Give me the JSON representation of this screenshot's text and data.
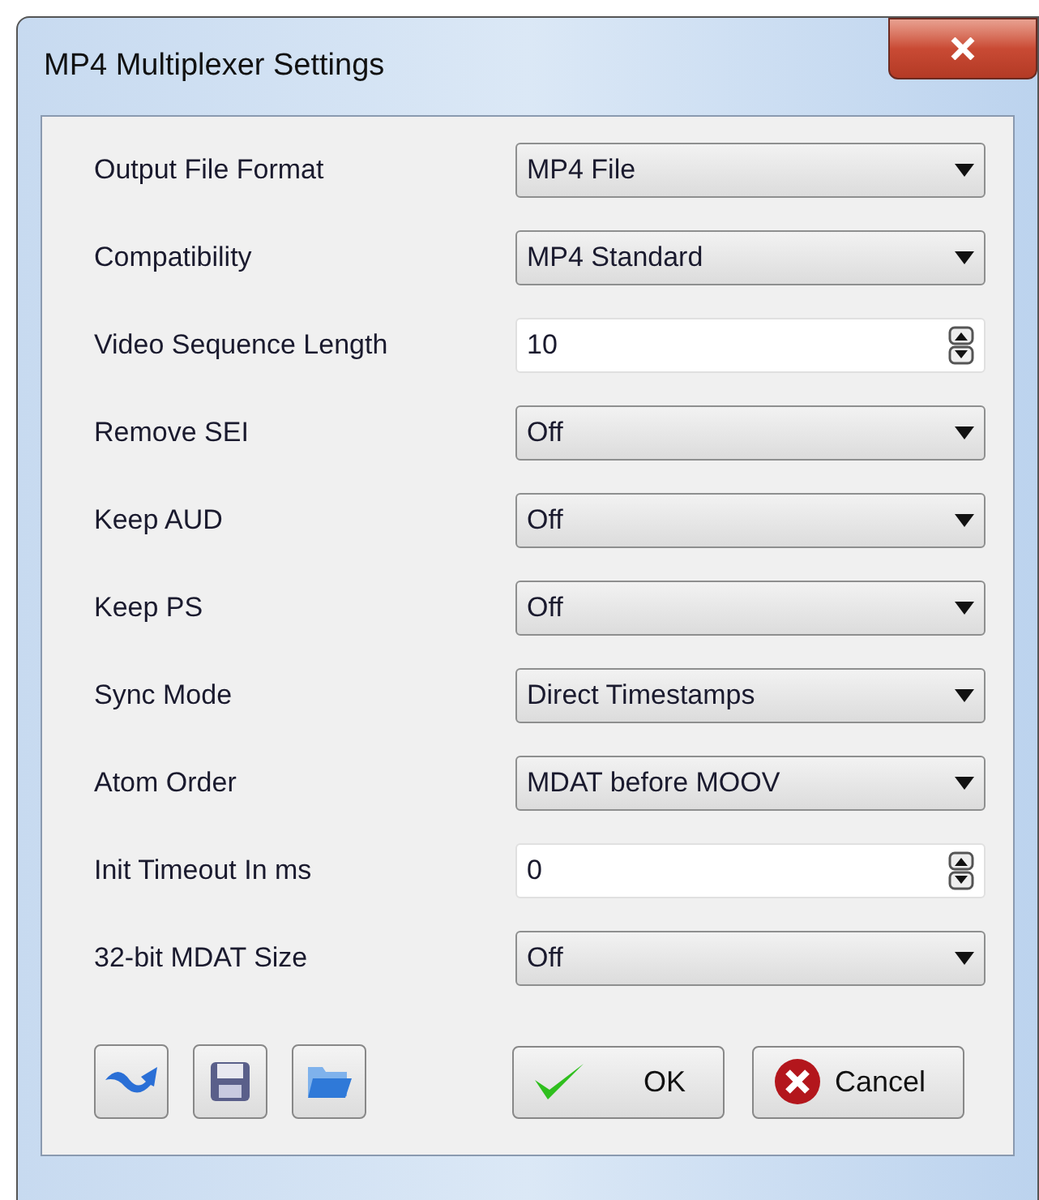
{
  "window": {
    "title": "MP4 Multiplexer Settings"
  },
  "settings": [
    {
      "label": "Output File Format",
      "kind": "dropdown",
      "value": "MP4 File"
    },
    {
      "label": "Compatibility",
      "kind": "dropdown",
      "value": "MP4 Standard"
    },
    {
      "label": "Video Sequence Length",
      "kind": "spin",
      "value": "10"
    },
    {
      "label": "Remove SEI",
      "kind": "dropdown",
      "value": "Off"
    },
    {
      "label": "Keep AUD",
      "kind": "dropdown",
      "value": "Off"
    },
    {
      "label": "Keep PS",
      "kind": "dropdown",
      "value": "Off"
    },
    {
      "label": "Sync Mode",
      "kind": "dropdown",
      "value": "Direct Timestamps"
    },
    {
      "label": "Atom Order",
      "kind": "dropdown",
      "value": "MDAT before MOOV"
    },
    {
      "label": "Init Timeout In ms",
      "kind": "spin",
      "value": "0"
    },
    {
      "label": "32-bit MDAT Size",
      "kind": "dropdown",
      "value": "Off"
    }
  ],
  "buttons": [
    "OK",
    "Cancel"
  ]
}
